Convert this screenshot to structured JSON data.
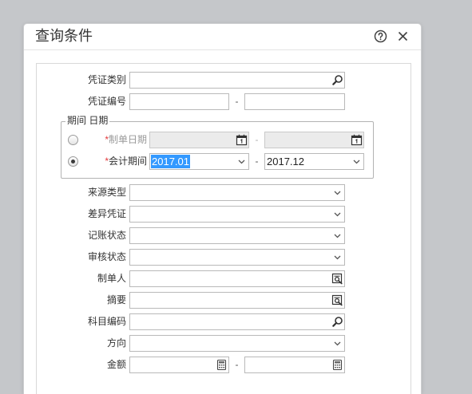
{
  "dialog": {
    "title": "查询条件",
    "help_icon": "help-circle-icon",
    "close_icon": "close-icon"
  },
  "form": {
    "voucher_type": {
      "label": "凭证类别",
      "value": "",
      "icon": "search-icon"
    },
    "voucher_number": {
      "label": "凭证编号",
      "from": "",
      "separator": "-",
      "to": ""
    },
    "period_group": {
      "legend": "期间 日期",
      "by_date": {
        "required_mark": "*",
        "label": "制单日期",
        "checked": false,
        "disabled": true,
        "from": "",
        "separator": "-",
        "to": "",
        "icon": "calendar-icon"
      },
      "by_period": {
        "required_mark": "*",
        "label": "会计期间",
        "checked": true,
        "from": "2017.01",
        "separator": "-",
        "to": "2017.12",
        "icon": "chevron-down-icon"
      }
    },
    "source_type": {
      "label": "来源类型",
      "value": "",
      "icon": "chevron-down-icon"
    },
    "difference_voucher": {
      "label": "差异凭证",
      "value": "",
      "icon": "chevron-down-icon"
    },
    "posting_status": {
      "label": "记账状态",
      "value": "",
      "icon": "chevron-down-icon"
    },
    "audit_status": {
      "label": "审核状态",
      "value": "",
      "icon": "chevron-down-icon"
    },
    "creator": {
      "label": "制单人",
      "value": "",
      "icon": "search-list-icon"
    },
    "summary": {
      "label": "摘要",
      "value": "",
      "icon": "search-list-icon"
    },
    "account_code": {
      "label": "科目编码",
      "value": "",
      "icon": "search-icon"
    },
    "direction": {
      "label": "方向",
      "value": "",
      "icon": "chevron-down-icon"
    },
    "amount": {
      "label": "金额",
      "from": "",
      "separator": "-",
      "to": "",
      "icon": "calculator-icon"
    }
  },
  "colors": {
    "backdrop": "#c5c7ca",
    "required_mark": "#e4393c",
    "selection_highlight": "#3399ff"
  }
}
